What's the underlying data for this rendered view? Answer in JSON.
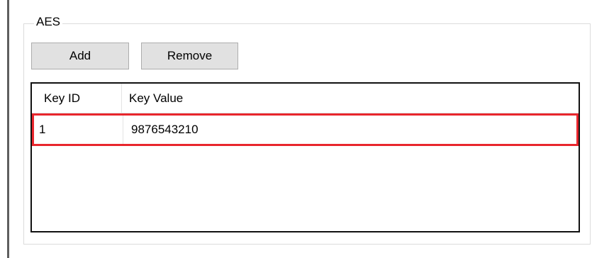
{
  "groupbox": {
    "title": "AES"
  },
  "toolbar": {
    "add_label": "Add",
    "remove_label": "Remove"
  },
  "keys_table": {
    "columns": [
      "Key ID",
      "Key Value"
    ],
    "rows": [
      {
        "key_id": "1",
        "key_value": "9876543210",
        "highlighted": true
      }
    ]
  },
  "colors": {
    "highlight_border": "#e8262d",
    "button_face": "#e1e1e1",
    "list_border": "#111111"
  }
}
